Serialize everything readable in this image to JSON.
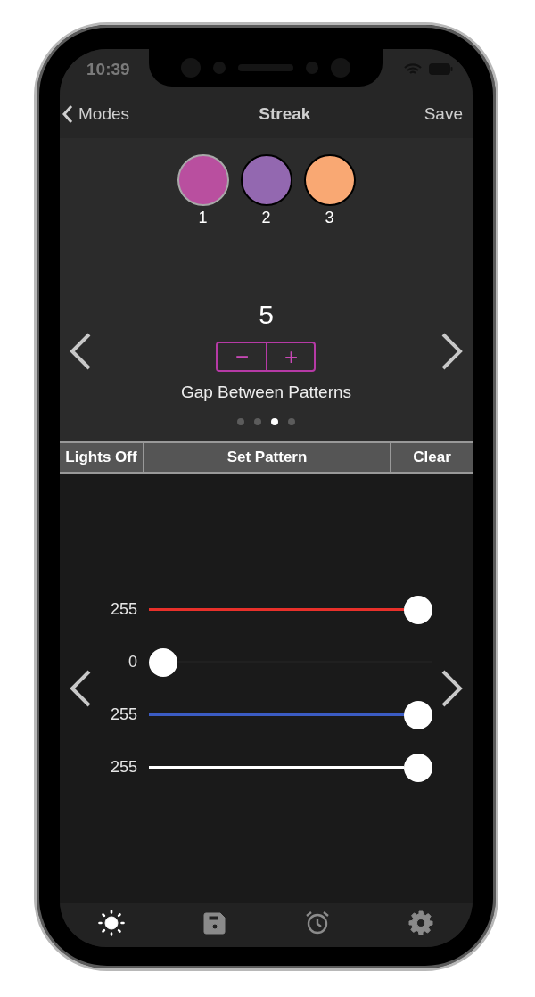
{
  "status_bar": {
    "time": "10:39"
  },
  "nav": {
    "back": "Modes",
    "title": "Streak",
    "action": "Save"
  },
  "swatches": [
    {
      "label": "1",
      "color": "#b94f9f",
      "selected": true
    },
    {
      "label": "2",
      "color": "#9368b0",
      "selected": false
    },
    {
      "label": "3",
      "color": "#f9a873",
      "selected": false
    }
  ],
  "setting": {
    "value": "5",
    "minus": "−",
    "plus": "+",
    "label": "Gap Between Patterns"
  },
  "pages": [
    {
      "selected": false
    },
    {
      "selected": false
    },
    {
      "selected": true
    },
    {
      "selected": false
    }
  ],
  "buttons": [
    "Lights Off",
    "Set Pattern",
    "Clear"
  ],
  "sliders": [
    {
      "reading": "255",
      "level": 1,
      "color": "#e8302a"
    },
    {
      "reading": "0",
      "level": 0
    },
    {
      "reading": "255",
      "level": 1,
      "color": "#3b5cc4"
    },
    {
      "reading": "255",
      "level": 1,
      "color": "#ffffff"
    }
  ],
  "tabs": [
    {
      "kind": "sun",
      "selected": true
    },
    {
      "kind": "disk",
      "selected": false
    },
    {
      "kind": "alarm",
      "selected": false
    },
    {
      "kind": "gear",
      "selected": false
    }
  ]
}
